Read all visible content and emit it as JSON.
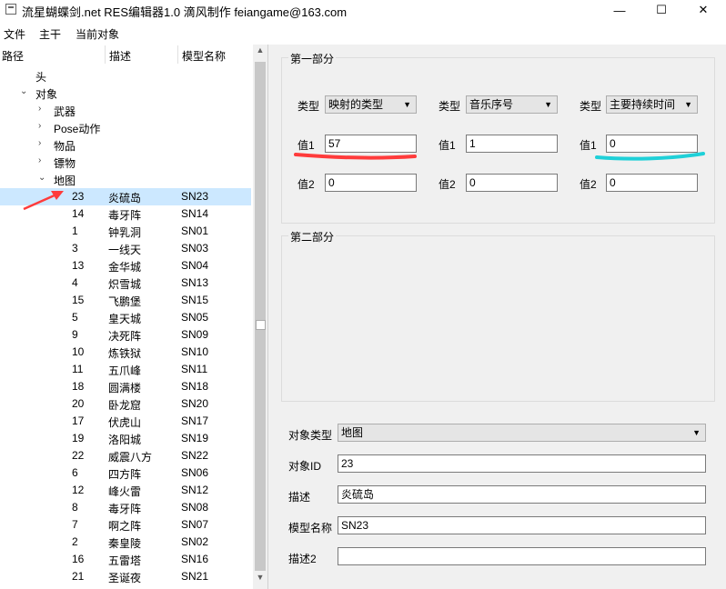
{
  "window": {
    "title": "流星蝴蝶剑.net RES编辑器1.0 滴风制作 feiangame@163.com",
    "minimize": "—",
    "maximize": "☐",
    "close": "✕"
  },
  "menu": [
    "文件",
    "主干",
    "当前对象"
  ],
  "tree": {
    "headers": [
      "路径",
      "描述",
      "模型名称"
    ],
    "nodes": [
      {
        "label": "头",
        "expander": ""
      },
      {
        "label": "对象",
        "expander": "⌄"
      },
      {
        "label": "武器",
        "expander": "›"
      },
      {
        "label": "Pose动作",
        "expander": "›"
      },
      {
        "label": "物品",
        "expander": "›"
      },
      {
        "label": "镖物",
        "expander": "›"
      },
      {
        "label": "地图",
        "expander": "⌄"
      }
    ],
    "rows": [
      {
        "id": "23",
        "desc": "炎硫岛",
        "model": "SN23",
        "selected": true
      },
      {
        "id": "14",
        "desc": "毒牙阵",
        "model": "SN14"
      },
      {
        "id": "1",
        "desc": "钟乳洞",
        "model": "SN01"
      },
      {
        "id": "3",
        "desc": "一线天",
        "model": "SN03"
      },
      {
        "id": "13",
        "desc": "金华城",
        "model": "SN04"
      },
      {
        "id": "4",
        "desc": "炽雪城",
        "model": "SN13"
      },
      {
        "id": "15",
        "desc": "飞鹏堡",
        "model": "SN15"
      },
      {
        "id": "5",
        "desc": "皇天城",
        "model": "SN05"
      },
      {
        "id": "9",
        "desc": "决死阵",
        "model": "SN09"
      },
      {
        "id": "10",
        "desc": "炼铁狱",
        "model": "SN10"
      },
      {
        "id": "11",
        "desc": "五爪峰",
        "model": "SN11"
      },
      {
        "id": "18",
        "desc": "圆满楼",
        "model": "SN18"
      },
      {
        "id": "20",
        "desc": "卧龙窟",
        "model": "SN20"
      },
      {
        "id": "17",
        "desc": "伏虎山",
        "model": "SN17"
      },
      {
        "id": "19",
        "desc": "洛阳城",
        "model": "SN19"
      },
      {
        "id": "22",
        "desc": "威震八方",
        "model": "SN22"
      },
      {
        "id": "6",
        "desc": "四方阵",
        "model": "SN06"
      },
      {
        "id": "12",
        "desc": "峰火雷",
        "model": "SN12"
      },
      {
        "id": "8",
        "desc": "毒牙阵",
        "model": "SN08"
      },
      {
        "id": "7",
        "desc": "啊之阵",
        "model": "SN07"
      },
      {
        "id": "2",
        "desc": "秦皇陵",
        "model": "SN02"
      },
      {
        "id": "16",
        "desc": "五雷塔",
        "model": "SN16"
      },
      {
        "id": "21",
        "desc": "圣诞夜",
        "model": "SN21"
      }
    ]
  },
  "part1": {
    "title": "第一部分",
    "columns": [
      {
        "type_label": "类型",
        "type_value": "映射的类型",
        "v1_label": "值1",
        "v1": "57",
        "v2_label": "值2",
        "v2": "0"
      },
      {
        "type_label": "类型",
        "type_value": "音乐序号",
        "v1_label": "值1",
        "v1": "1",
        "v2_label": "值2",
        "v2": "0"
      },
      {
        "type_label": "类型",
        "type_value": "主要持续时间",
        "v1_label": "值1",
        "v1": "0",
        "v2_label": "值2",
        "v2": "0"
      }
    ]
  },
  "part2": {
    "title": "第二部分"
  },
  "object": {
    "type_label": "对象类型",
    "type_value": "地图",
    "id_label": "对象ID",
    "id_value": "23",
    "desc_label": "描述",
    "desc_value": "炎硫岛",
    "model_label": "模型名称",
    "model_value": "SN23",
    "desc2_label": "描述2",
    "desc2_value": ""
  },
  "annotations": {
    "red": "#ff3b3b",
    "cyan": "#1fd0d8"
  }
}
